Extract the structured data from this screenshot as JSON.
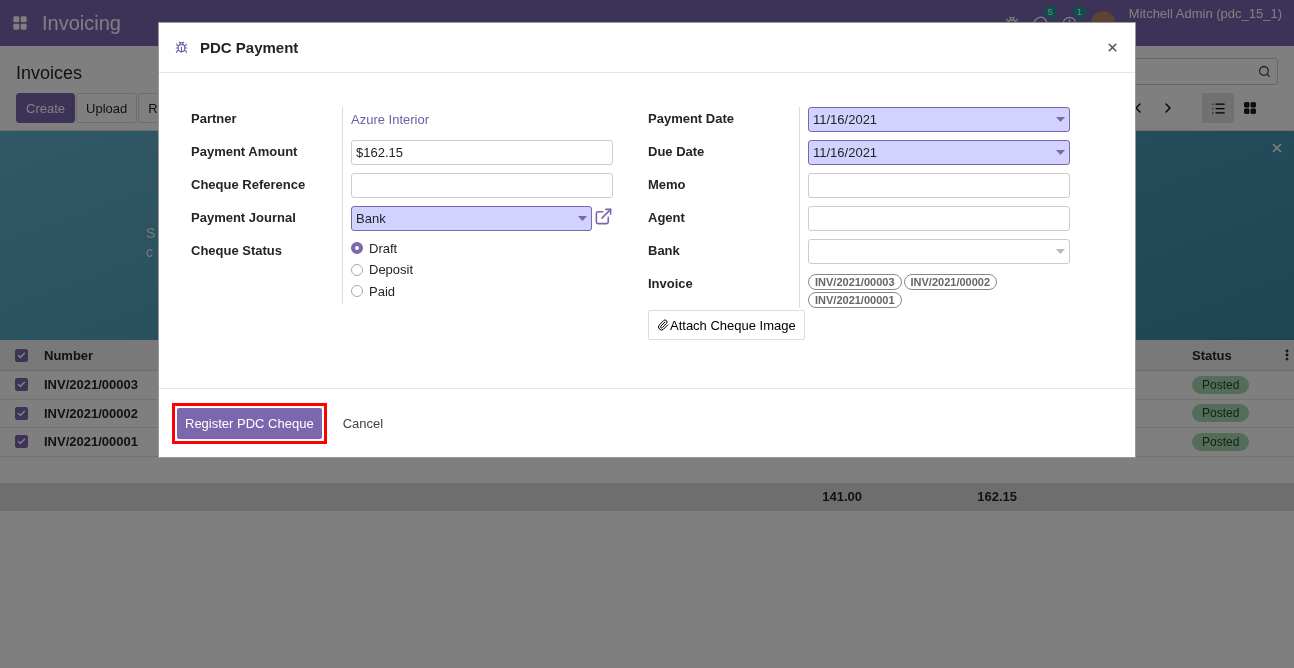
{
  "navbar": {
    "app_name": "Invoicing",
    "notifications": [
      {
        "kind": "chat",
        "count": "5"
      },
      {
        "kind": "activity",
        "count": "1"
      }
    ],
    "user": "Mitchell Admin (pdc_15_1)"
  },
  "control_panel": {
    "title": "Invoices",
    "buttons": [
      {
        "label": "Create",
        "primary": true
      },
      {
        "label": "Upload",
        "primary": false
      },
      {
        "label": "R",
        "primary": false
      }
    ],
    "views": [
      {
        "kind": "list",
        "selected": true
      },
      {
        "kind": "kanban",
        "selected": false
      }
    ]
  },
  "banner": {
    "lines": [
      "S",
      "c"
    ]
  },
  "table": {
    "header_checked": true,
    "number_header": "Number",
    "status_header": "Status",
    "rows": [
      {
        "checked": true,
        "number": "INV/2021/00003",
        "status": "Posted"
      },
      {
        "checked": true,
        "number": "INV/2021/00002",
        "status": "Posted"
      },
      {
        "checked": true,
        "number": "INV/2021/00001",
        "status": "Posted"
      }
    ],
    "totals": [
      "141.00",
      "162.15"
    ]
  },
  "dialog": {
    "title": "PDC Payment",
    "left_fields": [
      {
        "label": "Partner",
        "kind": "link",
        "value": "Azure Interior"
      },
      {
        "label": "Payment Amount",
        "kind": "input",
        "value": "$162.15"
      },
      {
        "label": "Cheque Reference",
        "kind": "input"
      },
      {
        "label": "Payment Journal",
        "kind": "select",
        "value": "Bank",
        "required": true,
        "external_link": true
      },
      {
        "label": "Cheque Status",
        "kind": "radio",
        "options": [
          {
            "label": "Draft",
            "selected": true
          },
          {
            "label": "Deposit",
            "selected": false
          },
          {
            "label": "Paid",
            "selected": false
          }
        ]
      }
    ],
    "right_fields": [
      {
        "label": "Payment Date",
        "kind": "select",
        "value": "11/16/2021",
        "required": true
      },
      {
        "label": "Due Date",
        "kind": "select",
        "value": "11/16/2021",
        "required": true
      },
      {
        "label": "Memo",
        "kind": "input"
      },
      {
        "label": "Agent",
        "kind": "input"
      },
      {
        "label": "Bank",
        "kind": "select",
        "required": false
      },
      {
        "label": "Invoice",
        "kind": "tags",
        "tags": [
          "INV/2021/00003",
          "INV/2021/00002",
          "INV/2021/00001"
        ]
      }
    ],
    "attach_button": "Attach Cheque Image",
    "primary_button": {
      "label": "Register PDC Cheque",
      "highlighted": true
    },
    "cancel_button": "Cancel"
  }
}
